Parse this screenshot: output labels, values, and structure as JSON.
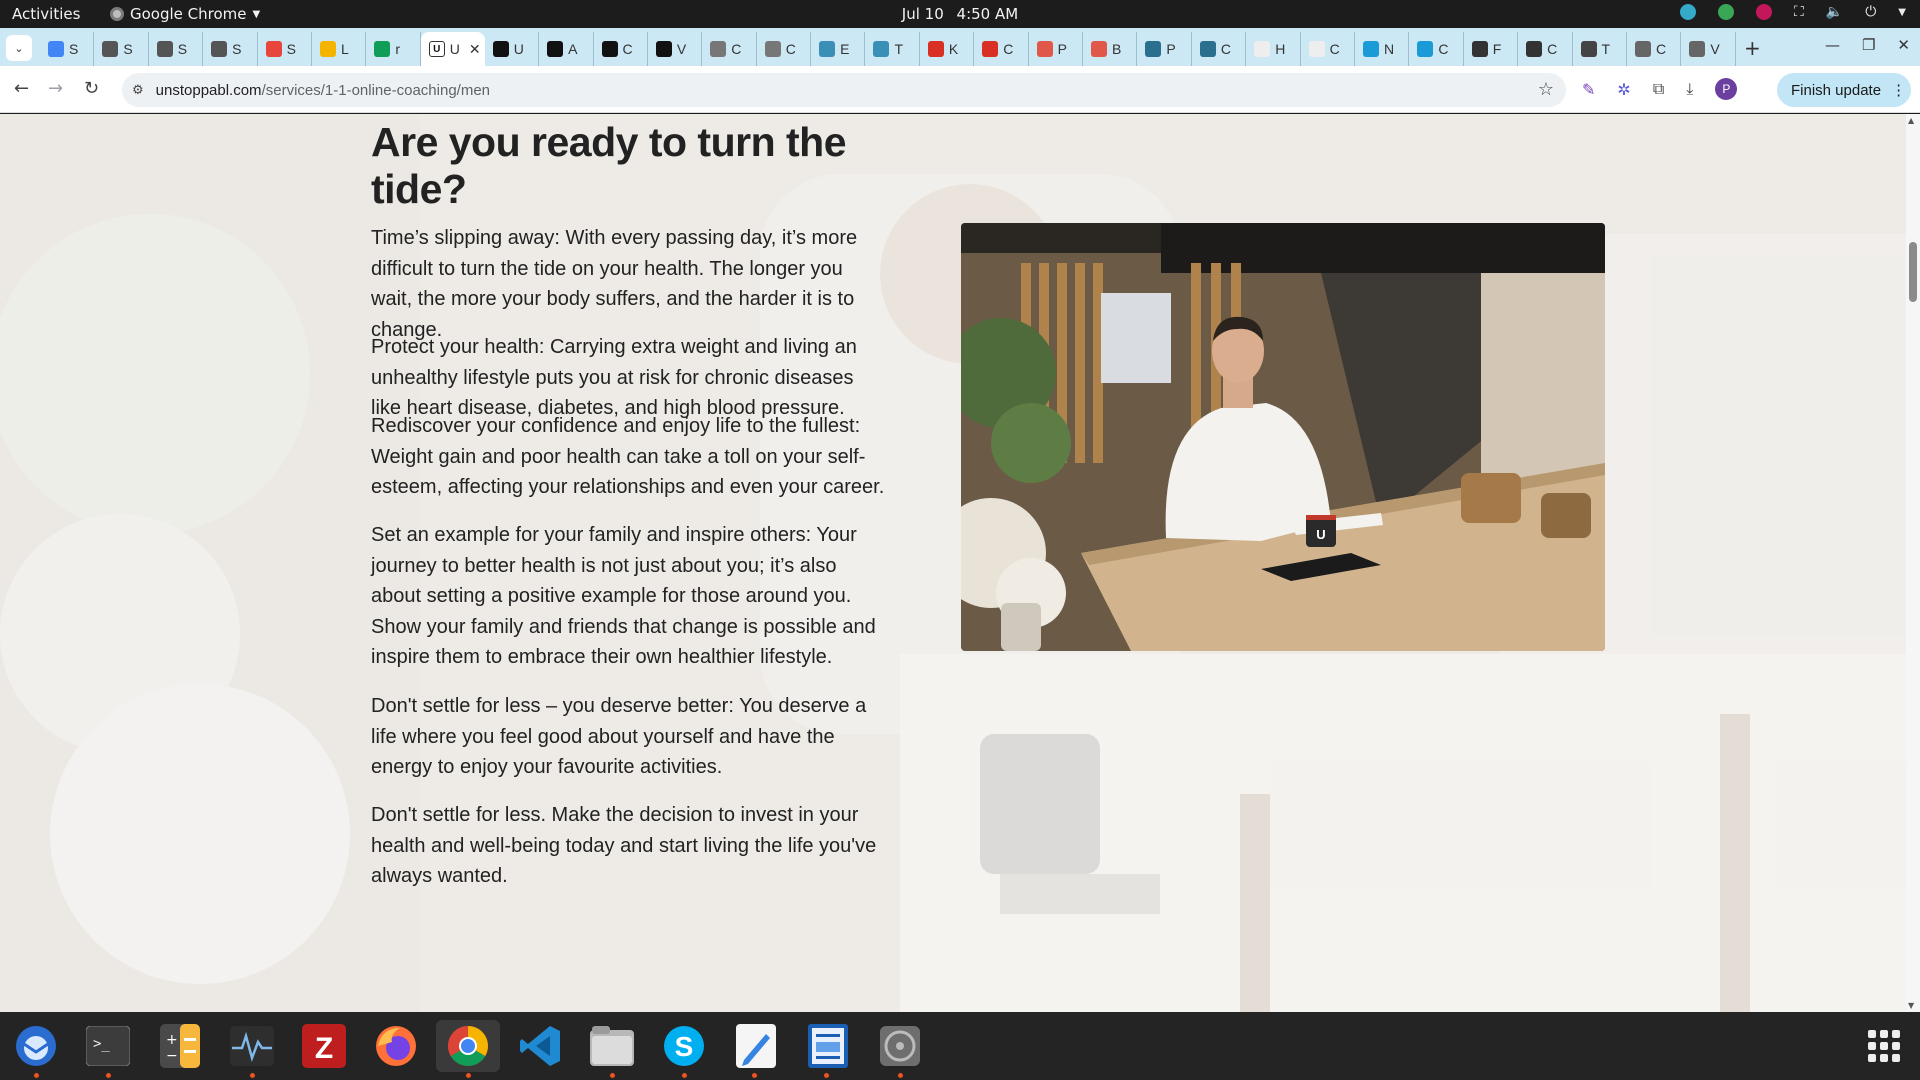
{
  "topbar": {
    "activities": "Activities",
    "app_name": "Google Chrome",
    "date": "Jul 10",
    "time": "4:50 AM"
  },
  "tabs": [
    {
      "letter": "S",
      "icon": "docs-icon",
      "color": "#4285f4"
    },
    {
      "letter": "S",
      "icon": "snp-icon",
      "color": "#555555"
    },
    {
      "letter": "S",
      "icon": "snp-icon",
      "color": "#555555"
    },
    {
      "letter": "S",
      "icon": "snp-icon",
      "color": "#555555"
    },
    {
      "letter": "S",
      "icon": "flame-icon",
      "color": "#e8453c"
    },
    {
      "letter": "L",
      "icon": "circle-icon",
      "color": "#f4b400"
    },
    {
      "letter": "r",
      "icon": "sheets-plus-icon",
      "color": "#0f9d58"
    },
    {
      "letter": "U",
      "icon": "unstoppabl-icon",
      "color": "#ffffff",
      "active": true
    },
    {
      "letter": "U",
      "icon": "unstoppabl-icon",
      "color": "#111111"
    },
    {
      "letter": "A",
      "icon": "unstoppabl-icon",
      "color": "#111111"
    },
    {
      "letter": "C",
      "icon": "unstoppabl-icon",
      "color": "#111111"
    },
    {
      "letter": "V",
      "icon": "unstoppabl-icon",
      "color": "#111111"
    },
    {
      "letter": "C",
      "icon": "chart-icon",
      "color": "#777777"
    },
    {
      "letter": "C",
      "icon": "chart-icon",
      "color": "#777777"
    },
    {
      "letter": "E",
      "icon": "grid-icon",
      "color": "#3a8fb7"
    },
    {
      "letter": "T",
      "icon": "grid-icon",
      "color": "#3a8fb7"
    },
    {
      "letter": "K",
      "icon": "pen-icon",
      "color": "#d93025"
    },
    {
      "letter": "C",
      "icon": "pen-icon",
      "color": "#d93025"
    },
    {
      "letter": "P",
      "icon": "link-icon",
      "color": "#e0584a"
    },
    {
      "letter": "B",
      "icon": "link-icon",
      "color": "#e0584a"
    },
    {
      "letter": "P",
      "icon": "figure-icon",
      "color": "#2b6f8f"
    },
    {
      "letter": "C",
      "icon": "figure-icon",
      "color": "#2b6f8f"
    },
    {
      "letter": "H",
      "icon": "smile-icon",
      "color": "#eeeeee"
    },
    {
      "letter": "C",
      "icon": "smile-icon",
      "color": "#eeeeee"
    },
    {
      "letter": "N",
      "icon": "globe-icon",
      "color": "#1a9bd7"
    },
    {
      "letter": "C",
      "icon": "globe-icon",
      "color": "#1a9bd7"
    },
    {
      "letter": "F",
      "icon": "dark-circle-icon",
      "color": "#333333"
    },
    {
      "letter": "C",
      "icon": "dark-circle-icon",
      "color": "#333333"
    },
    {
      "letter": "T",
      "icon": "github-icon",
      "color": "#444444"
    },
    {
      "letter": "C",
      "icon": "card-icon",
      "color": "#666666"
    },
    {
      "letter": "V",
      "icon": "card-icon",
      "color": "#666666"
    }
  ],
  "toolbar": {
    "url_host": "unstoppabl.com",
    "url_path": "/services/1-1-online-coaching/men",
    "finish_update": "Finish update",
    "profile_initial": "P"
  },
  "page": {
    "heading": "Are you ready to turn the tide?",
    "paragraphs": [
      "Time’s slipping away: With every passing day, it’s more difficult to turn the tide on your health. The longer you wait, the more your body suffers, and the harder it is to change.",
      "Protect your health: Carrying extra weight and living an unhealthy lifestyle puts you at risk for chronic diseases like heart disease, diabetes, and high blood pressure.",
      "Rediscover your confidence and enjoy life to the fullest: Weight gain and poor health can take a toll on your self-esteem, affecting your relationships and even your career.",
      "Set an example for your family and inspire others: Your journey to better health is not just about you; it’s also about setting a positive example for those around you. Show your family and friends that change is possible and inspire them to embrace their own healthier lifestyle.",
      "Don't settle for less – you deserve better: You deserve a life where you feel good about yourself and have the energy to enjoy your favourite activities.",
      "Don't settle for less. Make the decision to invest in your health and well-being today and start living the life you've always wanted."
    ],
    "mug_letter": "U"
  },
  "dock": [
    {
      "name": "thunderbird-icon",
      "running": true,
      "active": false
    },
    {
      "name": "terminal-icon",
      "running": true,
      "active": false
    },
    {
      "name": "calculator-icon",
      "running": false,
      "active": false
    },
    {
      "name": "system-monitor-icon",
      "running": true,
      "active": false
    },
    {
      "name": "filezilla-icon",
      "running": false,
      "active": false
    },
    {
      "name": "firefox-icon",
      "running": false,
      "active": false
    },
    {
      "name": "chrome-icon",
      "running": true,
      "active": true
    },
    {
      "name": "vscode-icon",
      "running": false,
      "active": false
    },
    {
      "name": "files-icon",
      "running": true,
      "active": false
    },
    {
      "name": "skype-icon",
      "running": true,
      "active": false
    },
    {
      "name": "text-editor-icon",
      "running": true,
      "active": false
    },
    {
      "name": "document-viewer-icon",
      "running": true,
      "active": false
    },
    {
      "name": "disc-icon",
      "running": true,
      "active": false
    }
  ],
  "colors": {
    "tabstrip": "#cde8f5",
    "finish_update_bg": "#c3e6f7",
    "running_indicator": "#e95420"
  }
}
